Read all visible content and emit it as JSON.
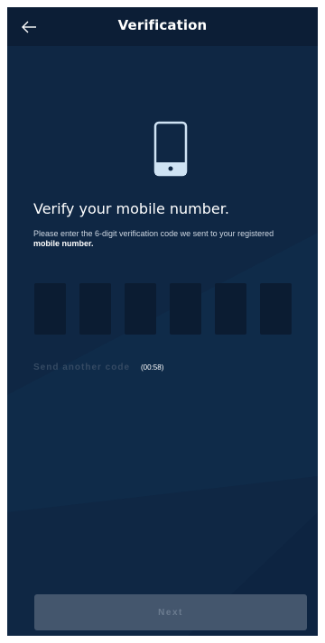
{
  "header": {
    "title": "Verification",
    "back_icon": "arrow-left-icon"
  },
  "hero": {
    "icon": "smartphone-icon"
  },
  "content": {
    "heading": "Verify your mobile number.",
    "instructions_prefix": "Please enter the 6-digit verification code we sent to your registered ",
    "instructions_emphasis": "mobile number.",
    "code_digits": [
      "",
      "",
      "",
      "",
      "",
      ""
    ]
  },
  "resend": {
    "label": "Send another code",
    "timer": "(00:58)"
  },
  "footer": {
    "next_label": "Next"
  },
  "colors": {
    "background": "#0f2744",
    "header": "#0c1e36",
    "code_box": "#0b1c32",
    "icon": "#cfe3f4",
    "button_disabled": "#44566d"
  }
}
